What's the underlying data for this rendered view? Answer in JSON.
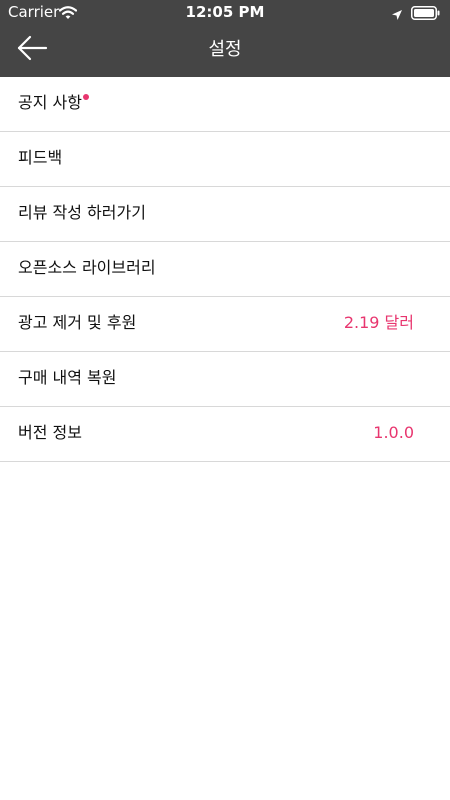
{
  "status_bar": {
    "carrier": "Carrier",
    "time": "12:05 PM",
    "icons": [
      "wifi-icon",
      "location-icon",
      "battery-icon"
    ]
  },
  "nav": {
    "title": "설정",
    "back_icon": "back-arrow-icon"
  },
  "colors": {
    "nav_background": "#454545",
    "accent": "#e8366f",
    "divider": "#d8d8d8"
  },
  "settings": {
    "items": [
      {
        "label": "공지 사항",
        "has_badge": true
      },
      {
        "label": "피드백"
      },
      {
        "label": "리뷰 작성 하러가기"
      },
      {
        "label": "오픈소스 라이브러리"
      },
      {
        "label": "광고 제거 및 후원",
        "value": "2.19 달러"
      },
      {
        "label": "구매 내역 복원"
      },
      {
        "label": "버전 정보",
        "value": "1.0.0"
      }
    ]
  }
}
